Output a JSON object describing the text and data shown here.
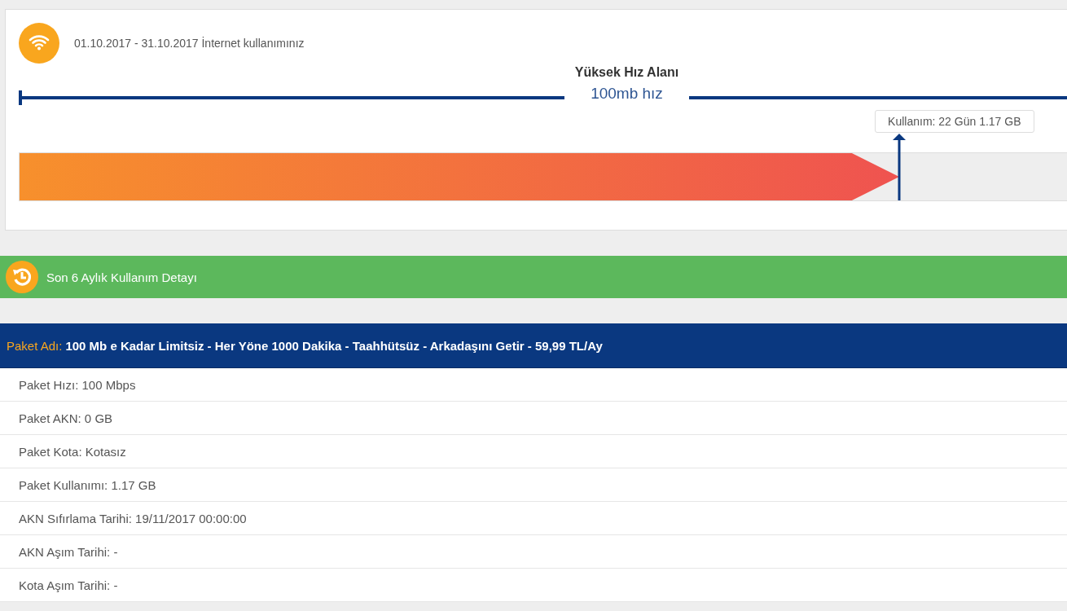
{
  "usage_card": {
    "period_text": "01.10.2017 - 31.10.2017 İnternet kullanımınız",
    "zone_title": "Yüksek Hız Alanı",
    "zone_speed": "100mb hız",
    "usage_label": "Kullanım: 22 Gün 1.17 GB",
    "level": 0.84
  },
  "history_bar": {
    "title": "Son 6 Aylık Kullanım Detayı"
  },
  "package": {
    "label": "Paket Adı:",
    "name": "100 Mb e Kadar Limitsiz - Her Yöne 1000 Dakika - Taahhütsüz - Arkadaşını Getir - 59,99 TL/Ay",
    "details": [
      "Paket Hızı: 100 Mbps",
      "Paket AKN: 0 GB",
      "Paket Kota: Kotasız",
      "Paket Kullanımı: 1.17 GB",
      "AKN Sıfırlama Tarihi: 19/11/2017 00:00:00",
      "AKN Aşım Tarihi: -",
      "Kota Aşım Tarihi: -"
    ]
  }
}
